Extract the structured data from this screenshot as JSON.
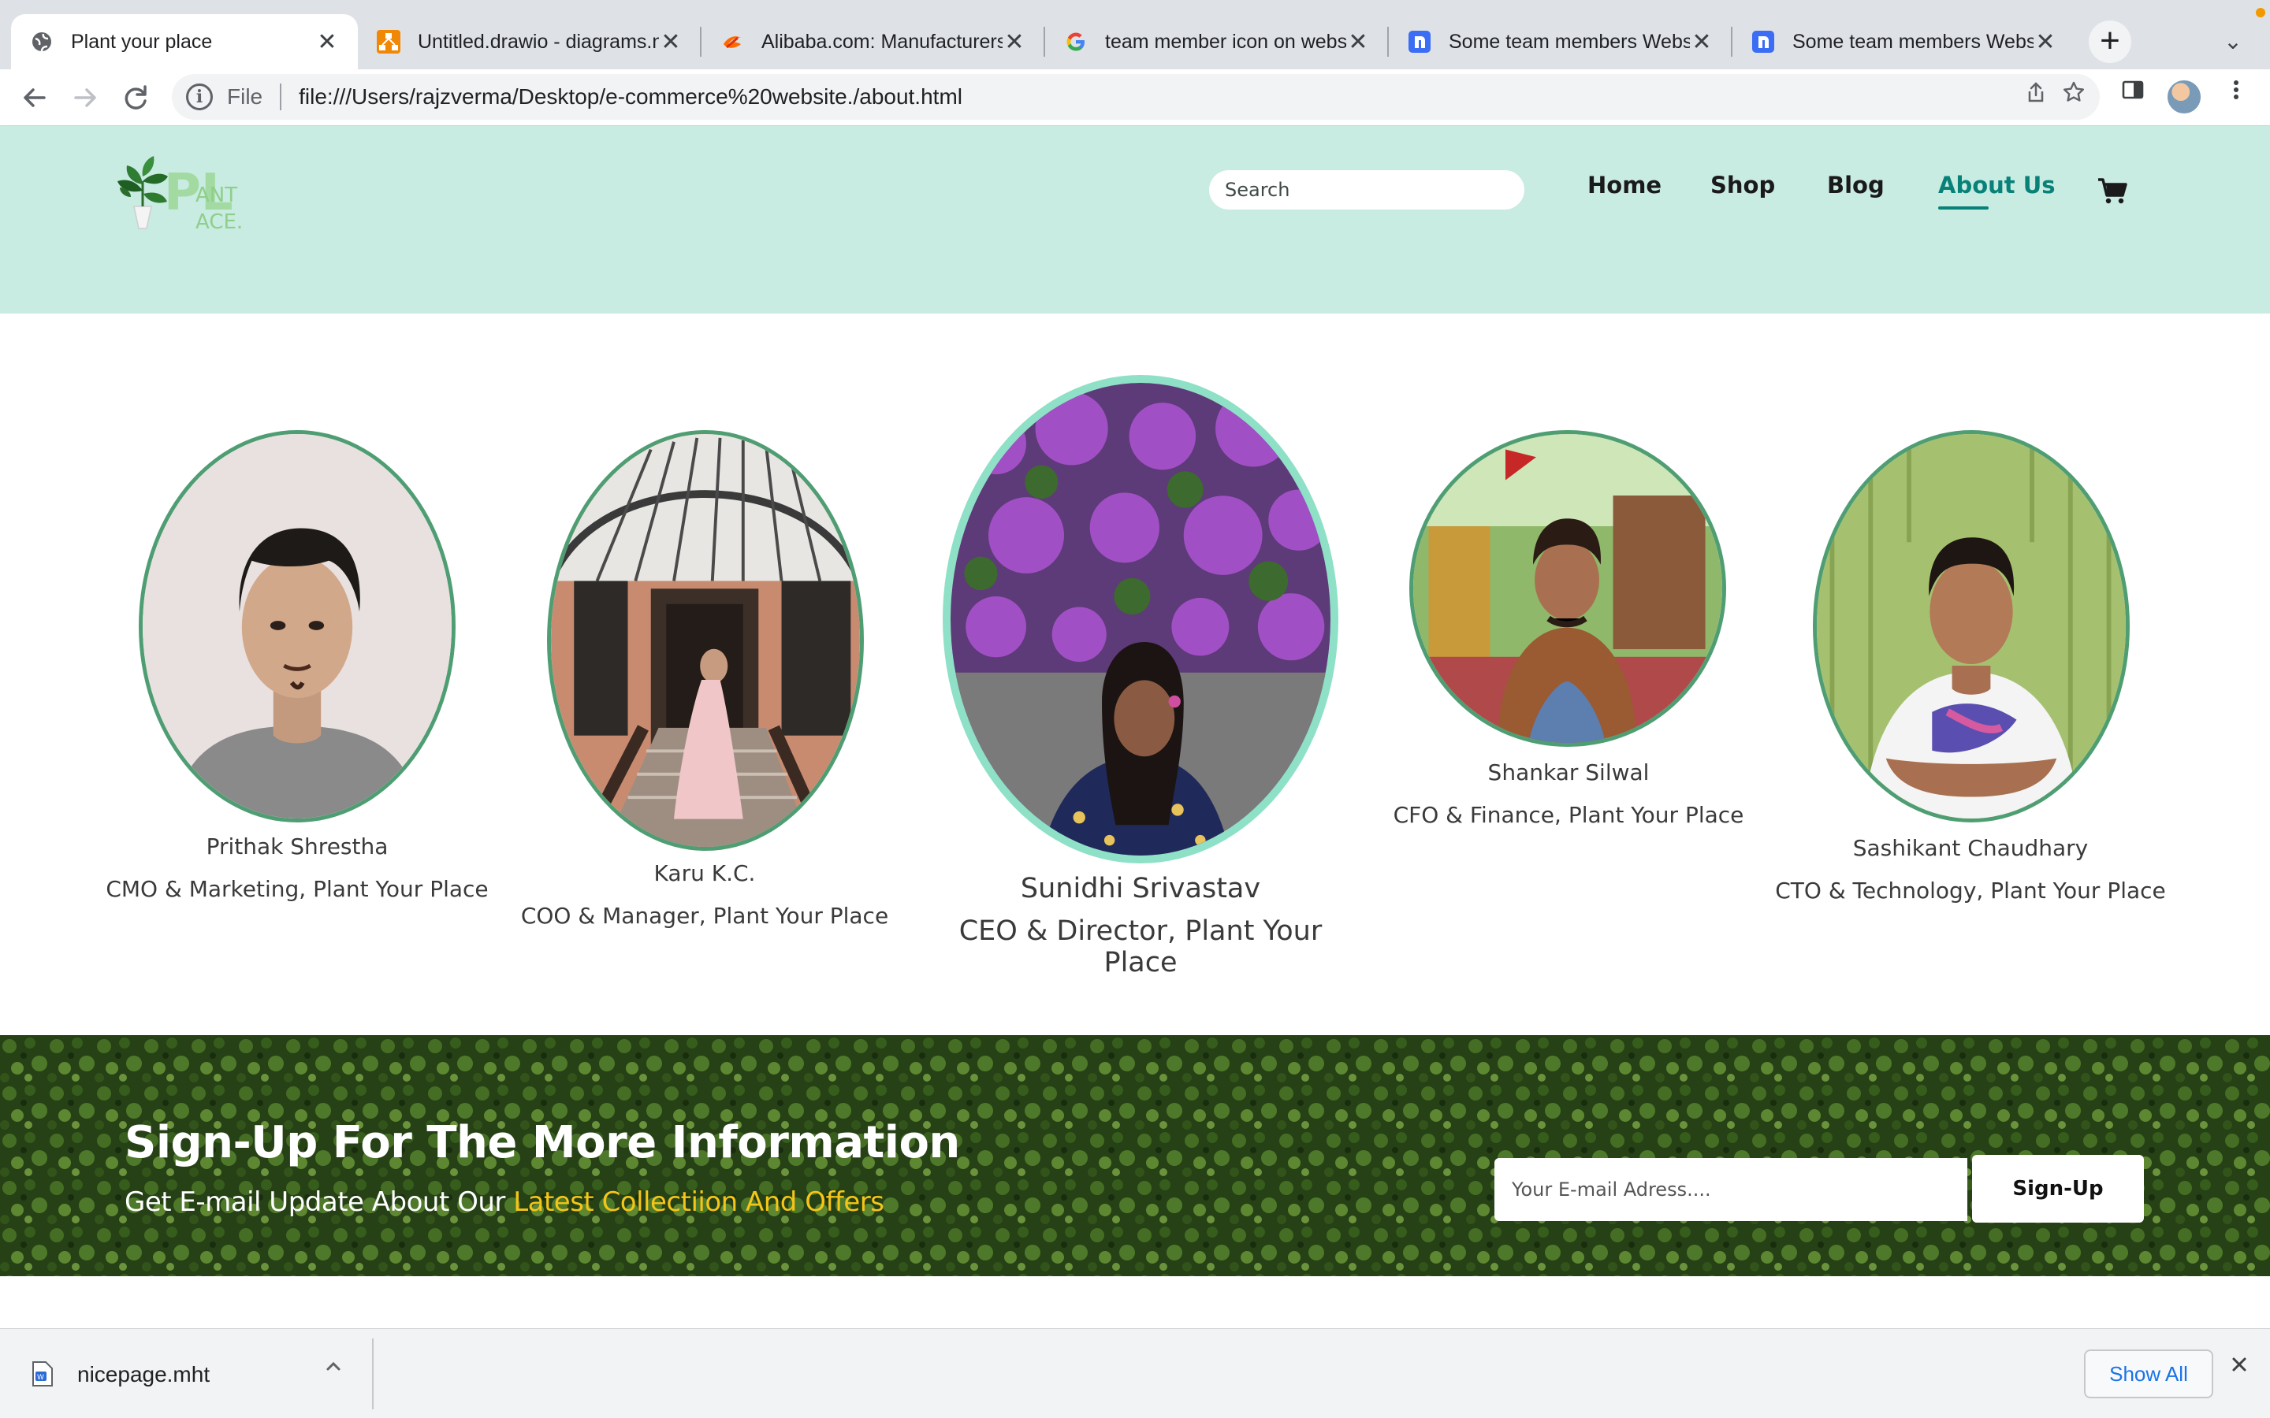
{
  "browser": {
    "tabs": [
      {
        "title": "Plant your place",
        "icon": "globe-icon",
        "active": true
      },
      {
        "title": "Untitled.drawio - diagrams.net",
        "icon": "drawio-icon",
        "active": false
      },
      {
        "title": "Alibaba.com: Manufacturers",
        "icon": "alibaba-icon",
        "active": false
      },
      {
        "title": "team member icon on website",
        "icon": "google-icon",
        "active": false
      },
      {
        "title": "Some team members Website",
        "icon": "nicepage-icon",
        "active": false
      },
      {
        "title": "Some team members Website",
        "icon": "nicepage-icon",
        "active": false
      }
    ],
    "close_glyph": "✕",
    "new_tab_glyph": "+",
    "tab_search_glyph": "⌄",
    "address": {
      "scheme_label": "File",
      "url": "file:///Users/rajzverma/Desktop/e-commerce%20website./about.html"
    }
  },
  "site": {
    "logo_text": "PLANT PLACE",
    "search_placeholder": "Search",
    "nav": {
      "home": "Home",
      "shop": "Shop",
      "blog": "Blog",
      "about": "About Us"
    },
    "accent_color": "#088178",
    "header_color": "#c8ebe2"
  },
  "team": [
    {
      "name": "Prithak Shrestha",
      "role": "CMO & Marketing, Plant Your Place"
    },
    {
      "name": "Karu K.C.",
      "role": "COO & Manager, Plant Your Place"
    },
    {
      "name": "Sunidhi Srivastav",
      "role": "CEO & Director, Plant Your Place"
    },
    {
      "name": "Shankar Silwal",
      "role": "CFO & Finance, Plant Your Place"
    },
    {
      "name": "Sashikant Chaudhary",
      "role": "CTO & Technology, Plant Your Place"
    }
  ],
  "newsletter": {
    "title": "Sign-Up For The More Information",
    "subtitle_prefix": "Get E-mail Update About Our ",
    "subtitle_highlight": "Latest Collectiion And Offers",
    "email_placeholder": "Your E-mail Adress....",
    "button": "Sign-Up"
  },
  "downloads": {
    "file_name": "nicepage.mht",
    "show_all": "Show All"
  }
}
